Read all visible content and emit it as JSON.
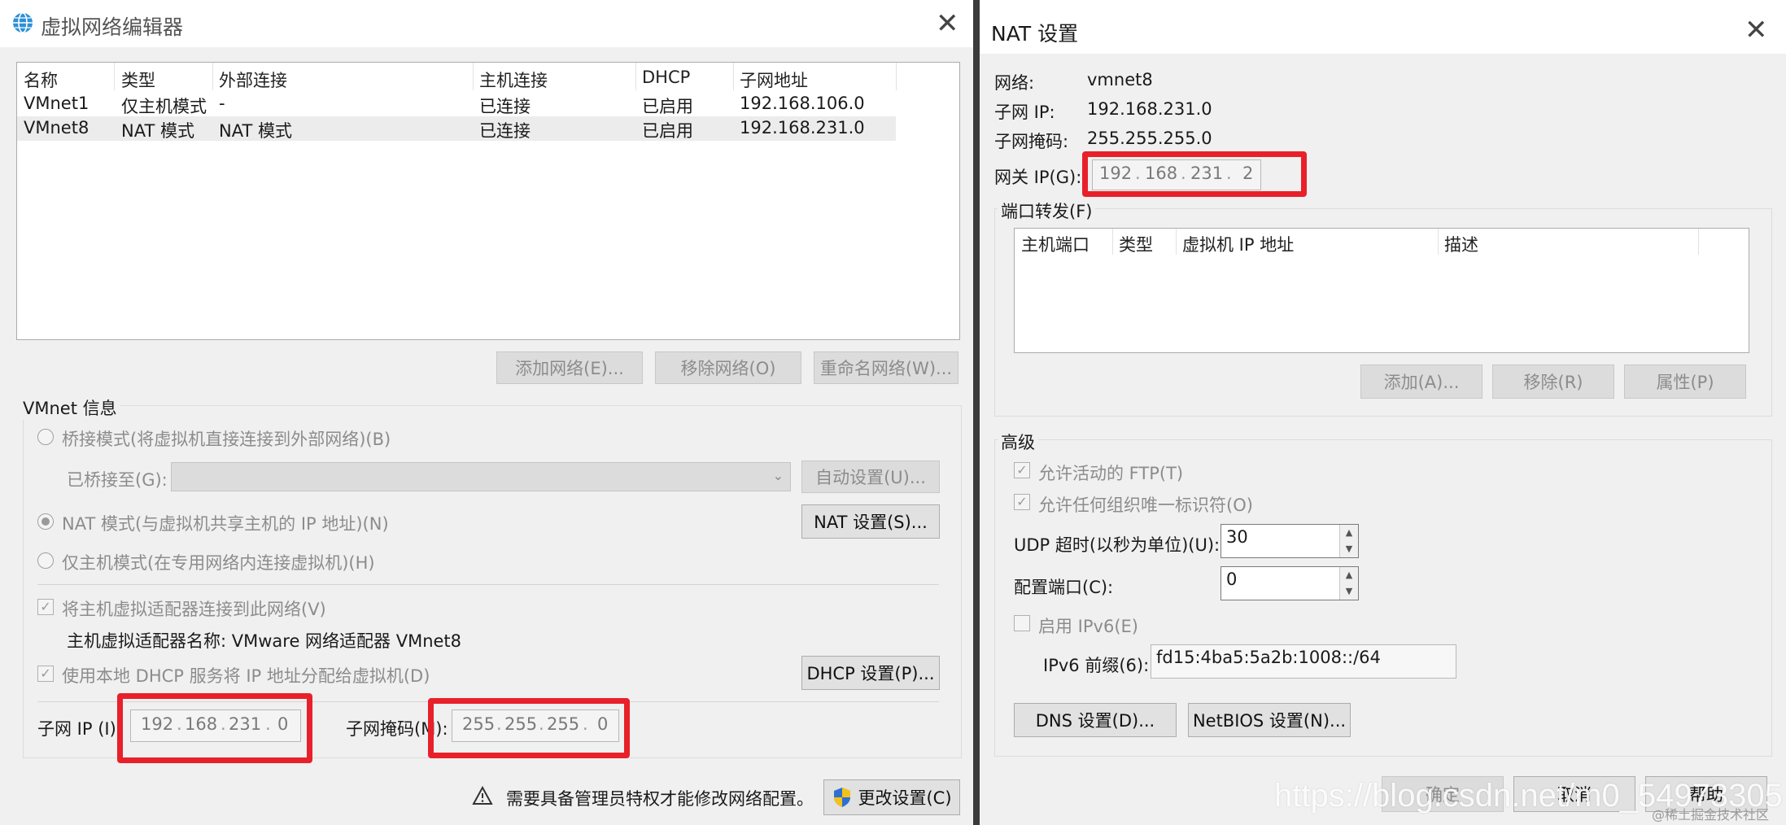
{
  "left": {
    "title": "虚拟网络编辑器",
    "table": {
      "headers": [
        "名称",
        "类型",
        "外部连接",
        "主机连接",
        "DHCP",
        "子网地址"
      ],
      "rows": [
        [
          "VMnet1",
          "仅主机模式",
          "-",
          "已连接",
          "已启用",
          "192.168.106.0"
        ],
        [
          "VMnet8",
          "NAT 模式",
          "NAT 模式",
          "已连接",
          "已启用",
          "192.168.231.0"
        ]
      ]
    },
    "buttons": {
      "add": "添加网络(E)...",
      "remove": "移除网络(O)",
      "rename": "重命名网络(W)..."
    },
    "vmnet_info": {
      "label": "VMnet 信息",
      "bridge_radio": "桥接模式(将虚拟机直接连接到外部网络)(B)",
      "bridged_to": "已桥接至(G):",
      "auto_button": "自动设置(U)...",
      "nat_radio": "NAT 模式(与虚拟机共享主机的 IP 地址)(N)",
      "nat_button": "NAT 设置(S)...",
      "hostonly_radio": "仅主机模式(在专用网络内连接虚拟机)(H)",
      "connect_adapter": "将主机虚拟适配器连接到此网络(V)",
      "adapter_name": "主机虚拟适配器名称: VMware 网络适配器 VMnet8",
      "dhcp_check": "使用本地 DHCP 服务将 IP 地址分配给虚拟机(D)",
      "dhcp_button": "DHCP 设置(P)...",
      "subnet_ip_label": "子网 IP (I)",
      "subnet_ip": [
        "192",
        "168",
        "231",
        "0"
      ],
      "subnet_mask_label": "子网掩码(M):",
      "subnet_mask": [
        "255",
        "255",
        "255",
        "0"
      ]
    },
    "footer": {
      "warning": "需要具备管理员特权才能修改网络配置。",
      "change_button": "更改设置(C)"
    }
  },
  "right": {
    "title": "NAT 设置",
    "network_label": "网络:",
    "network_value": "vmnet8",
    "subnet_ip_label": "子网 IP:",
    "subnet_ip_value": "192.168.231.0",
    "subnet_mask_label": "子网掩码:",
    "subnet_mask_value": "255.255.255.0",
    "gateway_label": "网关 IP(G):",
    "gateway": [
      "192",
      "168",
      "231",
      "2"
    ],
    "port_forward": {
      "label": "端口转发(F)",
      "headers": [
        "主机端口",
        "类型",
        "虚拟机 IP 地址",
        "描述"
      ],
      "buttons": {
        "add": "添加(A)...",
        "remove": "移除(R)",
        "props": "属性(P)"
      }
    },
    "advanced": {
      "label": "高级",
      "ftp": "允许活动的 FTP(T)",
      "oui": "允许任何组织唯一标识符(O)",
      "udp_label": "UDP 超时(以秒为单位)(U):",
      "udp_value": "30",
      "config_port_label": "配置端口(C):",
      "config_port_value": "0",
      "ipv6_check": "启用 IPv6(E)",
      "ipv6_prefix_label": "IPv6 前缀(6):",
      "ipv6_prefix_value": "fd15:4ba5:5a2b:1008::/64",
      "dns_button": "DNS 设置(D)...",
      "netbios_button": "NetBIOS 设置(N)..."
    },
    "footer": {
      "ok": "确定",
      "cancel": "取消",
      "help": "帮助"
    }
  },
  "watermark": {
    "url": "https://blog.csdn.net/m0_54973305",
    "badge": "@稀土掘金技术社区"
  },
  "colors": {
    "highlight": "#e8202a"
  }
}
